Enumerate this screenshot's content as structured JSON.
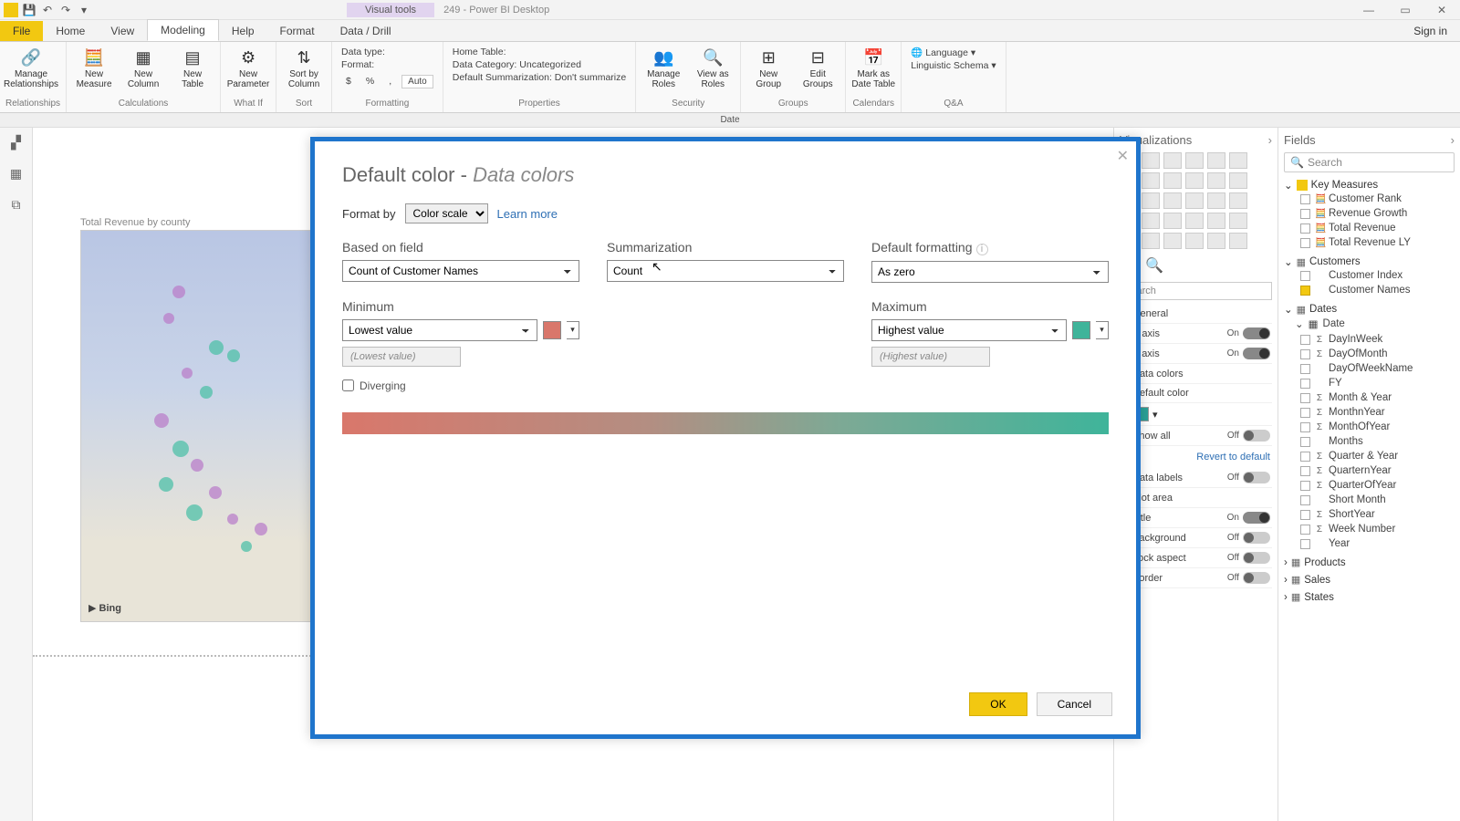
{
  "titlebar": {
    "visual_tools": "Visual tools",
    "title": "249 - Power BI Desktop"
  },
  "menutabs": {
    "file": "File",
    "home": "Home",
    "view": "View",
    "modeling": "Modeling",
    "help": "Help",
    "format": "Format",
    "datadrill": "Data / Drill",
    "signin": "Sign in"
  },
  "ribbon": {
    "relationships": {
      "manage": "Manage\nRelationships",
      "group": "Relationships"
    },
    "calc": {
      "measure": "New\nMeasure",
      "column": "New\nColumn",
      "table": "New\nTable",
      "group": "Calculations"
    },
    "whatif": {
      "param": "New\nParameter",
      "group": "What If"
    },
    "sort": {
      "sort": "Sort by\nColumn",
      "group": "Sort"
    },
    "formatting": {
      "datatype": "Data type:",
      "format": "Format:",
      "auto": "Auto",
      "group": "Formatting"
    },
    "properties": {
      "hometable": "Home Table:",
      "datacat": "Data Category: Uncategorized",
      "summ": "Default Summarization: Don't summarize",
      "group": "Properties"
    },
    "security": {
      "manageroles": "Manage\nRoles",
      "viewas": "View as\nRoles",
      "group": "Security"
    },
    "groups": {
      "new": "New\nGroup",
      "edit": "Edit\nGroups",
      "group": "Groups"
    },
    "calendars": {
      "mark": "Mark as\nDate Table",
      "group": "Calendars"
    },
    "qa": {
      "language": "Language",
      "schema": "Linguistic Schema",
      "group": "Q&A"
    }
  },
  "datestrip": "Date",
  "canvas": {
    "map_title": "Total Revenue by county",
    "bing": "Bing"
  },
  "vizpanel": {
    "title": "Visualizations",
    "search": "Search",
    "general": "General",
    "xaxis": "X axis",
    "yaxis": "Y axis",
    "datacolors": "Data colors",
    "defaultcolor": "Default color",
    "showall": "Show all",
    "revert": "Revert to default",
    "datalabels": "Data labels",
    "plotarea": "Plot area",
    "title_row": "Title",
    "background": "Background",
    "lockaspect": "Lock aspect",
    "border": "Border",
    "on": "On",
    "off": "Off"
  },
  "fields": {
    "title": "Fields",
    "search": "Search",
    "keymeasures": {
      "name": "Key Measures",
      "items": [
        "Customer Rank",
        "Revenue Growth",
        "Total Revenue",
        "Total Revenue LY"
      ]
    },
    "customers": {
      "name": "Customers",
      "items": [
        {
          "n": "Customer Index",
          "c": false
        },
        {
          "n": "Customer Names",
          "c": true
        }
      ]
    },
    "dates": {
      "name": "Dates",
      "date": "Date",
      "items": [
        {
          "n": "DayInWeek",
          "s": "Σ"
        },
        {
          "n": "DayOfMonth",
          "s": "Σ"
        },
        {
          "n": "DayOfWeekName",
          "s": ""
        },
        {
          "n": "FY",
          "s": ""
        },
        {
          "n": "Month & Year",
          "s": "Σ"
        },
        {
          "n": "MonthnYear",
          "s": "Σ"
        },
        {
          "n": "MonthOfYear",
          "s": "Σ"
        },
        {
          "n": "Months",
          "s": ""
        },
        {
          "n": "Quarter & Year",
          "s": "Σ"
        },
        {
          "n": "QuarternYear",
          "s": "Σ"
        },
        {
          "n": "QuarterOfYear",
          "s": "Σ"
        },
        {
          "n": "Short Month",
          "s": ""
        },
        {
          "n": "ShortYear",
          "s": "Σ"
        },
        {
          "n": "Week Number",
          "s": "Σ"
        },
        {
          "n": "Year",
          "s": ""
        }
      ]
    },
    "products": "Products",
    "sales": "Sales",
    "states": "States"
  },
  "modal": {
    "title_a": "Default color - ",
    "title_b": "Data colors",
    "formatby": "Format by",
    "formatby_val": "Color scale",
    "learn": "Learn more",
    "basedon": "Based on field",
    "basedon_val": "Count of Customer Names",
    "summ": "Summarization",
    "summ_val": "Count",
    "deffmt": "Default formatting",
    "deffmt_val": "As zero",
    "min": "Minimum",
    "min_val": "Lowest value",
    "min_ph": "(Lowest value)",
    "max": "Maximum",
    "max_val": "Highest value",
    "max_ph": "(Highest value)",
    "diverging": "Diverging",
    "ok": "OK",
    "cancel": "Cancel"
  }
}
